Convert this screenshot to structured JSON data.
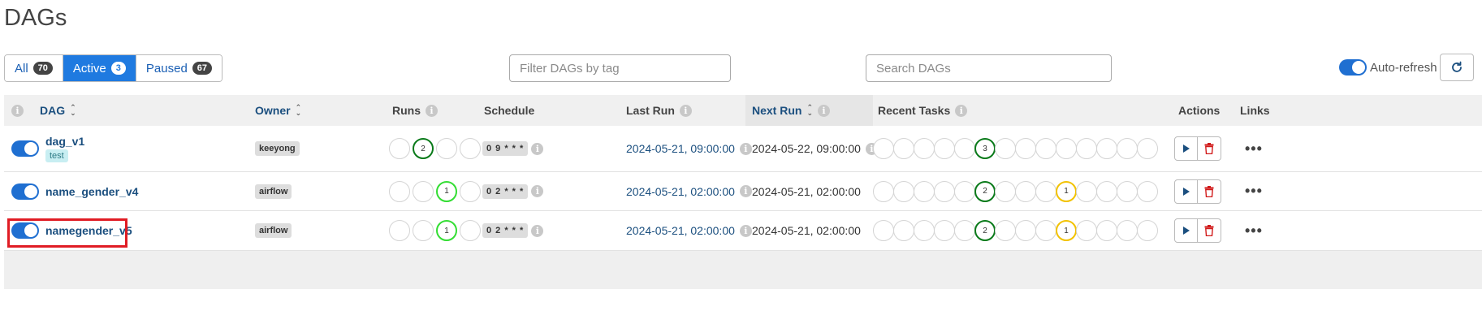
{
  "page": {
    "title": "DAGs"
  },
  "filters": {
    "all": {
      "label": "All",
      "count": "70"
    },
    "active": {
      "label": "Active",
      "count": "3"
    },
    "paused": {
      "label": "Paused",
      "count": "67"
    },
    "tag_placeholder": "Filter DAGs by tag",
    "search_placeholder": "Search DAGs",
    "autorefresh_label": "Auto-refresh"
  },
  "columns": {
    "dag": "DAG",
    "owner": "Owner",
    "runs": "Runs",
    "schedule": "Schedule",
    "last_run": "Last Run",
    "next_run": "Next Run",
    "recent_tasks": "Recent Tasks",
    "actions": "Actions",
    "links": "Links"
  },
  "rows": [
    {
      "name": "dag_v1",
      "tag": "test",
      "owner": "keeyong",
      "schedule": "0 9 * * *",
      "last_run": "2024-05-21, 09:00:00",
      "next_run": "2024-05-22, 09:00:00",
      "runs": [
        "",
        "2",
        "",
        ""
      ],
      "tasks": [
        "",
        "",
        "",
        "",
        "",
        "3",
        "",
        "",
        "",
        "",
        "",
        "",
        "",
        ""
      ]
    },
    {
      "name": "name_gender_v4",
      "owner": "airflow",
      "schedule": "0 2 * * *",
      "last_run": "2024-05-21, 02:00:00",
      "next_run": "2024-05-21, 02:00:00",
      "runs": [
        "",
        "",
        "1",
        ""
      ],
      "tasks": [
        "",
        "",
        "",
        "",
        "",
        "2",
        "",
        "",
        "",
        "1",
        "",
        "",
        "",
        ""
      ]
    },
    {
      "name": "namegender_v5",
      "owner": "airflow",
      "schedule": "0 2 * * *",
      "last_run": "2024-05-21, 02:00:00",
      "next_run": "2024-05-21, 02:00:00",
      "runs": [
        "",
        "",
        "1",
        ""
      ],
      "tasks": [
        "",
        "",
        "",
        "",
        "",
        "2",
        "",
        "",
        "",
        "1",
        "",
        "",
        "",
        ""
      ]
    }
  ],
  "colors": {
    "accent": "#1f7ae0",
    "success": "#0a7a1a",
    "running": "#33dd33",
    "queued": "#f2c200",
    "highlight": "#e01c24"
  }
}
